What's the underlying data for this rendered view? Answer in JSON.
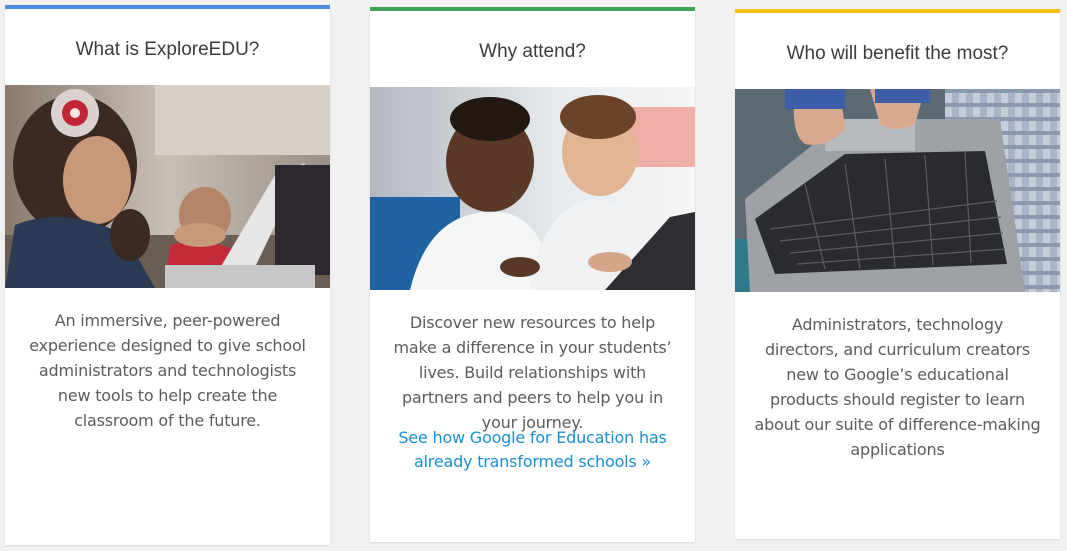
{
  "cards": [
    {
      "accent": "#4a8ae0",
      "title": "What is ExploreEDU?",
      "image": "children-using-chromebooks-photo",
      "body": "An immersive, peer-powered experience designed to give school administrators and technologists new tools to help create the classroom of the future."
    },
    {
      "accent": "#3aa655",
      "title": "Why attend?",
      "image": "students-sharing-laptop-photo",
      "body": "Discover new resources to help make a difference in your students’ lives. Build relationships with partners and peers to help you in your journey.",
      "link": "See how Google for Education has already transformed schools »"
    },
    {
      "accent": "#f2bf1b",
      "title": "Who will benefit the most?",
      "image": "hands-on-laptop-keyboard-photo",
      "body": "Administrators, technology directors, and curriculum creators new to Google’s educational products should register to learn about our suite of difference-making applications"
    }
  ]
}
